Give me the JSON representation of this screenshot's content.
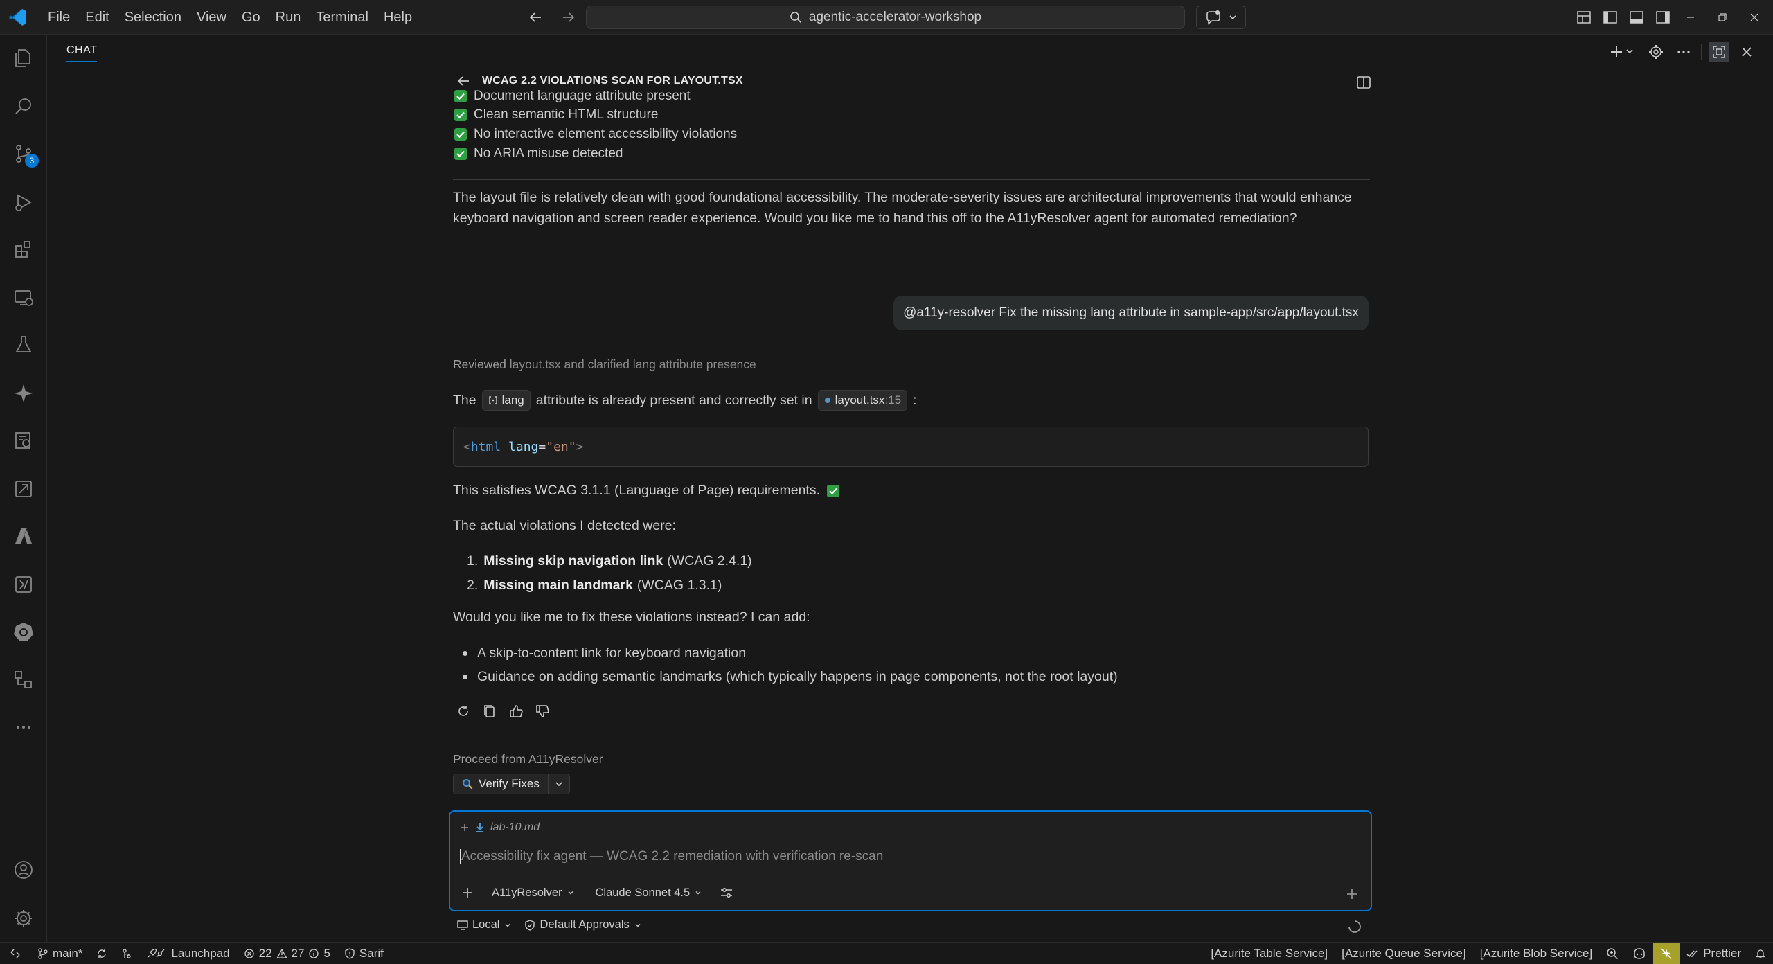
{
  "titlebar": {
    "menu": [
      "File",
      "Edit",
      "Selection",
      "View",
      "Go",
      "Run",
      "Terminal",
      "Help"
    ],
    "search_text": "agentic-accelerator-workshop"
  },
  "activitybar": {
    "source_control_badge": "3"
  },
  "chat": {
    "tab_label": "CHAT",
    "session_title": "WCAG 2.2 VIOLATIONS SCAN FOR LAYOUT.TSX",
    "checks": [
      "Document language attribute present",
      "Clean semantic HTML structure",
      "No interactive element accessibility violations",
      "No ARIA misuse detected"
    ],
    "summary_line1": "The layout file is relatively clean with good foundational accessibility. The moderate-severity issues are architectural improvements that would enhance",
    "summary_line2": "keyboard navigation and screen reader experience. Would you like me to hand this off to the A11yResolver agent for automated remediation?",
    "user_message": "@a11y-resolver Fix the missing lang attribute in sample-app/src/app/layout.tsx",
    "reviewed_prefix": "Reviewed",
    "reviewed_rest": "layout.tsx and clarified lang attribute presence",
    "inline_pre": "The",
    "inline_chip1": "lang",
    "inline_mid": "attribute is already present and correctly set in",
    "inline_chip2_file": "layout.tsx",
    "inline_chip2_line": ":15",
    "inline_post": ":",
    "code": {
      "open": "<",
      "tag": "html",
      "attr": "lang",
      "eq": "=",
      "val": "\"en\"",
      "close": ">"
    },
    "satisfies": "This satisfies WCAG 3.1.1 (Language of Page) requirements.",
    "actual_intro": "The actual violations I detected were:",
    "violations": [
      {
        "num": "1.",
        "bold": "Missing skip navigation link",
        "rest": "(WCAG 2.4.1)"
      },
      {
        "num": "2.",
        "bold": "Missing main landmark",
        "rest": "(WCAG 1.3.1)"
      }
    ],
    "question": "Would you like me to fix these violations instead? I can add:",
    "bullets": [
      "A skip-to-content link for keyboard navigation",
      "Guidance on adding semantic landmarks (which typically happens in page components, not the root layout)"
    ],
    "proceed_label": "Proceed from A11yResolver",
    "verify_label": "Verify Fixes"
  },
  "input": {
    "context_file": "lab-10.md",
    "placeholder": "Accessibility fix agent — WCAG 2.2 remediation with verification re-scan",
    "agent": "A11yResolver",
    "model": "Claude Sonnet 4.5",
    "location": "Local",
    "approvals": "Default Approvals"
  },
  "statusbar": {
    "branch": "main*",
    "launchpad": "Launchpad",
    "errors": "22",
    "warnings": "27",
    "infos": "5",
    "sarif": "Sarif",
    "azurite_table": "[Azurite Table Service]",
    "azurite_queue": "[Azurite Queue Service]",
    "azurite_blob": "[Azurite Blob Service]",
    "prettier": "Prettier"
  },
  "colors": {
    "accent": "#0078d4",
    "check_green": "#2ea043",
    "status_highlight": "#a7a02a"
  }
}
